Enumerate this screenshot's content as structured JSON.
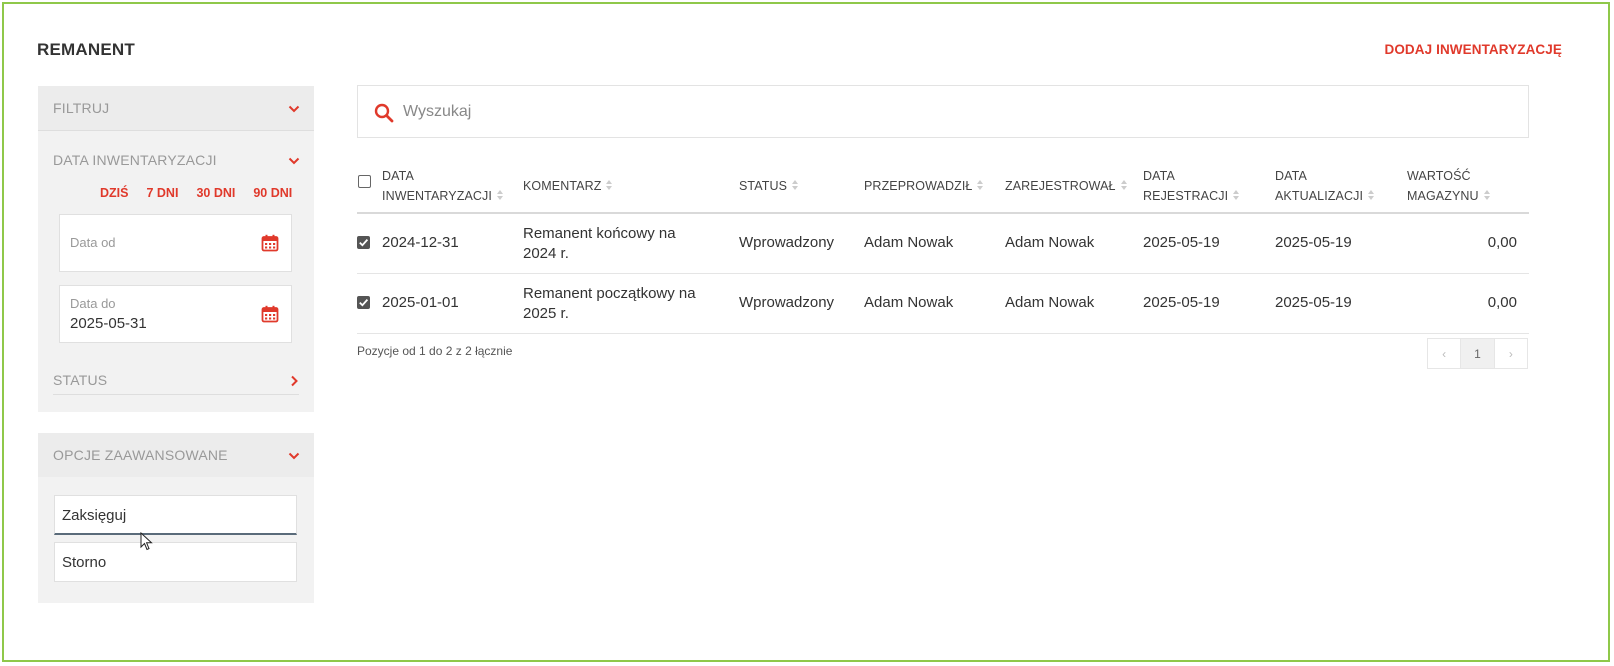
{
  "page": {
    "title": "REMANENT",
    "add_link": "DODAJ INWENTARYZACJĘ"
  },
  "sidebar": {
    "filter_label": "FILTRUJ",
    "date_section_label": "DATA INWENTARYZACJI",
    "quick_ranges": [
      "DZIŚ",
      "7 DNI",
      "30 DNI",
      "90 DNI"
    ],
    "date_from_label": "Data od",
    "date_from_value": "",
    "date_to_label": "Data do",
    "date_to_value": "2025-05-31",
    "status_label": "STATUS"
  },
  "advanced": {
    "label": "OPCJE ZAAWANSOWANE",
    "buttons": [
      "Zaksięguj",
      "Storno"
    ]
  },
  "search": {
    "placeholder": "Wyszukaj",
    "value": ""
  },
  "table": {
    "columns": [
      [
        "DATA",
        "INWENTARYZACJI"
      ],
      [
        "KOMENTARZ"
      ],
      [
        "STATUS"
      ],
      [
        "PRZEPROWADZIŁ"
      ],
      [
        "ZAREJESTROWAŁ"
      ],
      [
        "DATA",
        "REJESTRACJI"
      ],
      [
        "DATA",
        "AKTUALIZACJI"
      ],
      [
        "WARTOŚĆ",
        "MAGAZYNU"
      ]
    ],
    "rows": [
      {
        "checked": true,
        "date": "2024-12-31",
        "comment": [
          "Remanent końcowy na",
          "2024 r."
        ],
        "status": "Wprowadzony",
        "conducted_by": "Adam Nowak",
        "registered_by": "Adam Nowak",
        "registration_date": "2025-05-19",
        "update_date": "2025-05-19",
        "value": "0,00"
      },
      {
        "checked": true,
        "date": "2025-01-01",
        "comment": [
          "Remanent początkowy na",
          "2025 r."
        ],
        "status": "Wprowadzony",
        "conducted_by": "Adam Nowak",
        "registered_by": "Adam Nowak",
        "registration_date": "2025-05-19",
        "update_date": "2025-05-19",
        "value": "0,00"
      }
    ],
    "summary": "Pozycje od 1 do 2 z 2 łącznie",
    "pagination": {
      "prev": "‹",
      "current": "1",
      "next": "›"
    }
  },
  "colors": {
    "accent": "#e0392b",
    "frame": "#8fc84a",
    "panel": "#f2f2f2"
  }
}
